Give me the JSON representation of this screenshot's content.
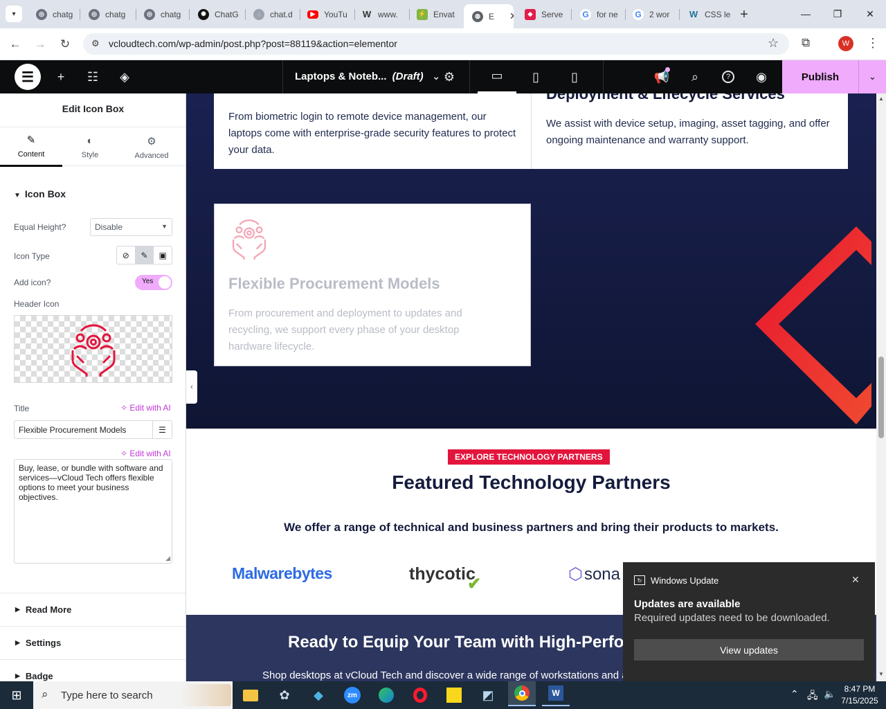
{
  "browser": {
    "tabs": [
      {
        "label": "chatg",
        "icon": "chatgpt-favicon-icon"
      },
      {
        "label": "chatg",
        "icon": "chatgpt-favicon-icon"
      },
      {
        "label": "chatg",
        "icon": "chatgpt-favicon-icon"
      },
      {
        "label": "ChatG",
        "icon": "openai-favicon-icon"
      },
      {
        "label": "chat.d",
        "icon": "deepseek-favicon-icon"
      },
      {
        "label": "YouTu",
        "icon": "youtube-favicon-icon"
      },
      {
        "label": "www.",
        "icon": "w-favicon-icon"
      },
      {
        "label": "Envat",
        "icon": "envato-favicon-icon"
      },
      {
        "label": "E",
        "icon": "globe-favicon-icon"
      },
      {
        "label": "Serve",
        "icon": "server-favicon-icon"
      },
      {
        "label": "for ne",
        "icon": "google-favicon-icon"
      },
      {
        "label": "2 wor",
        "icon": "google-favicon-icon"
      },
      {
        "label": "CSS le",
        "icon": "w-favicon-icon"
      }
    ],
    "url": "vcloudtech.com/wp-admin/post.php?post=88119&action=elementor",
    "profile_initial": "W"
  },
  "elementor_bar": {
    "doc_title": "Laptops & Noteb...",
    "doc_status": "(Draft)",
    "publish_label": "Publish"
  },
  "panel": {
    "title": "Edit Icon Box",
    "tabs": [
      "Content",
      "Style",
      "Advanced"
    ],
    "section_title": "Icon Box",
    "equal_height_label": "Equal Height?",
    "equal_height_value": "Disable",
    "icon_type_label": "Icon Type",
    "add_icon_label": "Add icon?",
    "add_icon_value": "Yes",
    "header_icon_label": "Header Icon",
    "title_label": "Title",
    "edit_ai_label": "Edit with AI",
    "title_value": "Flexible Procurement Models",
    "description_value": "Buy, lease, or bundle with software and services—vCloud Tech offers flexible options to meet your business objectives.",
    "sections": [
      "Read More",
      "Settings",
      "Badge"
    ]
  },
  "canvas": {
    "top_card_left_text": "From biometric login to remote device management, our laptops come with enterprise-grade security features to protect your data.",
    "top_card_right_heading": "Deployment & Lifecycle Services",
    "top_card_right_text": "We assist with device setup, imaging, asset tagging, and offer ongoing maintenance and warranty support.",
    "card_title": "Flexible Procurement Models",
    "card_text": "From procurement and deployment to updates and recycling, we support every phase of your desktop hardware lifecycle.",
    "partners_badge": "EXPLORE TECHNOLOGY PARTNERS",
    "partners_heading": "Featured Technology Partners",
    "partners_sub": "We offer a range of technical and business partners and bring their products to markets.",
    "logos": [
      "Malwarebytes",
      "thycotic",
      "sona"
    ],
    "cta_heading": "Ready to Equip Your Team with High-Perfo",
    "cta_text": "Shop desktops at vCloud Tech and discover a wide range of workstations and all-in-one PCs built for"
  },
  "notification": {
    "app": "Windows Update",
    "title": "Updates are available",
    "body": "Required updates need to be downloaded.",
    "button": "View updates"
  },
  "taskbar": {
    "search_placeholder": "Type here to search",
    "time": "8:47 PM",
    "date": "7/15/2025"
  },
  "colors": {
    "accent_red": "#e3153d",
    "navy": "#141b3c",
    "elementor_pink": "#f0abfc"
  }
}
